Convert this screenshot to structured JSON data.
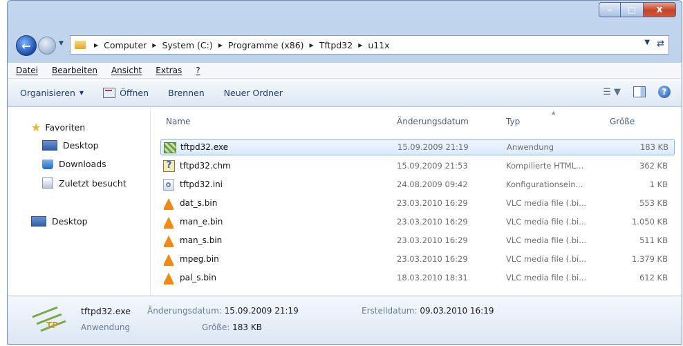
{
  "window": {
    "buttons": {
      "minimize": "–",
      "maximize": "□",
      "close": "x"
    }
  },
  "address": {
    "path": [
      "Computer",
      "System (C:)",
      "Programme (x86)",
      "Tftpd32",
      "u11x"
    ]
  },
  "menu": [
    "Datei",
    "Bearbeiten",
    "Ansicht",
    "Extras",
    "?"
  ],
  "toolbar": {
    "organize": "Organisieren",
    "open": "Öffnen",
    "burn": "Brennen",
    "new_folder": "Neuer Ordner"
  },
  "nav": {
    "favorites": "Favoriten",
    "items": [
      "Desktop",
      "Downloads",
      "Zuletzt besucht"
    ],
    "desktop": "Desktop"
  },
  "columns": {
    "name": "Name",
    "date": "Änderungsdatum",
    "type": "Typ",
    "size": "Größe"
  },
  "files": [
    {
      "name": "tftpd32.exe",
      "date": "15.09.2009 21:19",
      "type": "Anwendung",
      "size": "183 KB",
      "icon": "exe-icon"
    },
    {
      "name": "tftpd32.chm",
      "date": "15.09.2009 21:53",
      "type": "Kompilierte HTML...",
      "size": "362 KB",
      "icon": "chm-icon"
    },
    {
      "name": "tftpd32.ini",
      "date": "24.08.2009 09:42",
      "type": "Konfigurationsein...",
      "size": "1 KB",
      "icon": "ini-icon"
    },
    {
      "name": "dat_s.bin",
      "date": "23.03.2010 16:29",
      "type": "VLC media file (.bi...",
      "size": "553 KB",
      "icon": "vlc-icon"
    },
    {
      "name": "man_e.bin",
      "date": "23.03.2010 16:29",
      "type": "VLC media file (.bi...",
      "size": "1.050 KB",
      "icon": "vlc-icon"
    },
    {
      "name": "man_s.bin",
      "date": "23.03.2010 16:29",
      "type": "VLC media file (.bi...",
      "size": "511 KB",
      "icon": "vlc-icon"
    },
    {
      "name": "mpeg.bin",
      "date": "23.03.2010 16:29",
      "type": "VLC media file (.bi...",
      "size": "1.379 KB",
      "icon": "vlc-icon"
    },
    {
      "name": "pal_s.bin",
      "date": "18.03.2010 18:31",
      "type": "VLC media file (.bi...",
      "size": "612 KB",
      "icon": "vlc-icon"
    }
  ],
  "details": {
    "name": "tftpd32.exe",
    "modified_label": "Änderungsdatum:",
    "modified": "15.09.2009 21:19",
    "created_label": "Erstelldatum:",
    "created": "09.03.2010 16:19",
    "type": "Anwendung",
    "size_label": "Größe:",
    "size": "183 KB"
  }
}
